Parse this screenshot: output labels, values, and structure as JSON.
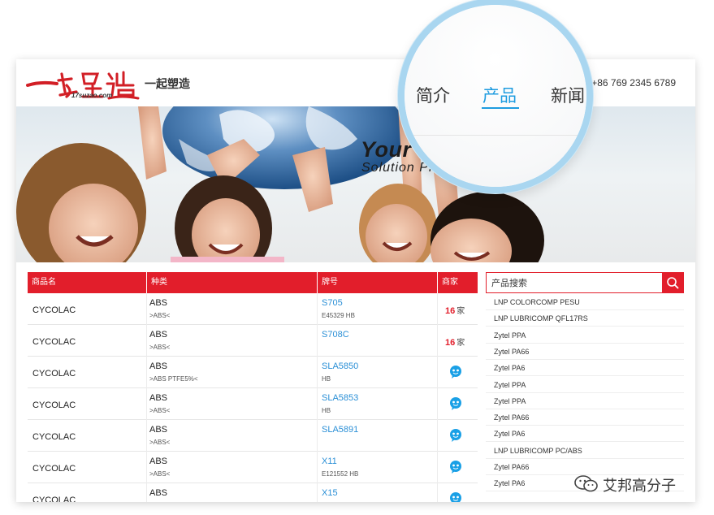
{
  "header": {
    "logo_text": "一起塑造",
    "logo_sub": "17suzao.com",
    "site_name": "一起塑造",
    "phone": "+86 769 2345 6789"
  },
  "nav": {
    "items": [
      {
        "label": "简介",
        "active": false
      },
      {
        "label": "产品",
        "active": true
      },
      {
        "label": "新闻",
        "active": false
      }
    ]
  },
  "banner": {
    "title": "Your                  Partner",
    "subtitle": "Solution Pr                  gineering Plastics"
  },
  "table": {
    "columns": [
      "商品名",
      "种类",
      "牌号",
      "商家"
    ],
    "rows": [
      {
        "brand": "CYCOLAC",
        "kind": "ABS",
        "kind_sub": ">ABS<",
        "code": "S705",
        "code_sub": "E45329 HB",
        "count": "16",
        "unit": "家",
        "chat": false
      },
      {
        "brand": "CYCOLAC",
        "kind": "ABS",
        "kind_sub": ">ABS<",
        "code": "S708C",
        "code_sub": "",
        "count": "16",
        "unit": "家",
        "chat": false
      },
      {
        "brand": "CYCOLAC",
        "kind": "ABS",
        "kind_sub": ">ABS PTFE5%<",
        "code": "SLA5850",
        "code_sub": "HB",
        "count": "",
        "unit": "",
        "chat": true
      },
      {
        "brand": "CYCOLAC",
        "kind": "ABS",
        "kind_sub": ">ABS<",
        "code": "SLA5853",
        "code_sub": "HB",
        "count": "",
        "unit": "",
        "chat": true
      },
      {
        "brand": "CYCOLAC",
        "kind": "ABS",
        "kind_sub": ">ABS<",
        "code": "SLA5891",
        "code_sub": "",
        "count": "",
        "unit": "",
        "chat": true
      },
      {
        "brand": "CYCOLAC",
        "kind": "ABS",
        "kind_sub": ">ABS<",
        "code": "X11",
        "code_sub": "E121552 HB",
        "count": "",
        "unit": "",
        "chat": true
      },
      {
        "brand": "CYCOLAC",
        "kind": "ABS",
        "kind_sub": "",
        "code": "X15",
        "code_sub": "",
        "count": "",
        "unit": "",
        "chat": true
      }
    ]
  },
  "search": {
    "placeholder": "产品搜索",
    "icon": "search-icon"
  },
  "product_list": [
    "LNP COLORCOMP PESU",
    "LNP LUBRICOMP QFL17RS",
    "Zytel PPA",
    "Zytel PA66",
    "Zytel PA6",
    "Zytel PPA",
    "Zytel PPA",
    "Zytel PA66",
    "Zytel PA6",
    "LNP LUBRICOMP PC/ABS",
    "Zytel PA66",
    "Zytel PA6"
  ],
  "watermark": {
    "text": "艾邦高分子",
    "icon": "wechat-icon"
  },
  "colors": {
    "brand_red": "#e21e2b",
    "link_blue": "#2a8fd6",
    "nav_active": "#1e9ce0",
    "magnifier_ring": "#a9d6f0"
  }
}
